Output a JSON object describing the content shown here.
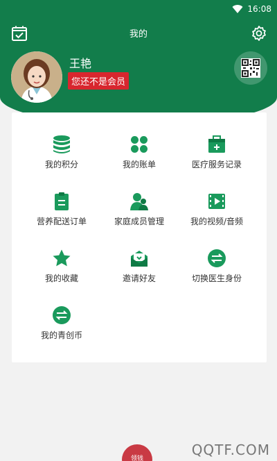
{
  "status": {
    "time": "16:08",
    "wifi_icon": "wifi-icon"
  },
  "nav": {
    "title": "我的",
    "left_icon": "calendar-icon",
    "right_icon": "gear-icon"
  },
  "profile": {
    "name": "王艳",
    "badge": "您还不是会员",
    "qr_icon": "qr-code-icon"
  },
  "grid": [
    {
      "label": "我的积分",
      "icon": "coins-icon"
    },
    {
      "label": "我的账单",
      "icon": "four-leaf-icon"
    },
    {
      "label": "医疗服务记录",
      "icon": "medical-kit-icon"
    },
    {
      "label": "营养配送订单",
      "icon": "clipboard-icon"
    },
    {
      "label": "家庭成员管理",
      "icon": "family-icon"
    },
    {
      "label": "我的视频/音频",
      "icon": "video-icon"
    },
    {
      "label": "我的收藏",
      "icon": "star-icon"
    },
    {
      "label": "邀请好友",
      "icon": "mail-icon"
    },
    {
      "label": "切换医生身份",
      "icon": "switch-icon"
    },
    {
      "label": "我的青创币",
      "icon": "switch-icon"
    }
  ],
  "bottom_peek": {
    "text": "领钱"
  },
  "watermark": "QQTF.COM",
  "colors": {
    "primary": "#127d4b",
    "badge": "#d8262e",
    "icon": "#1a9a5c"
  }
}
